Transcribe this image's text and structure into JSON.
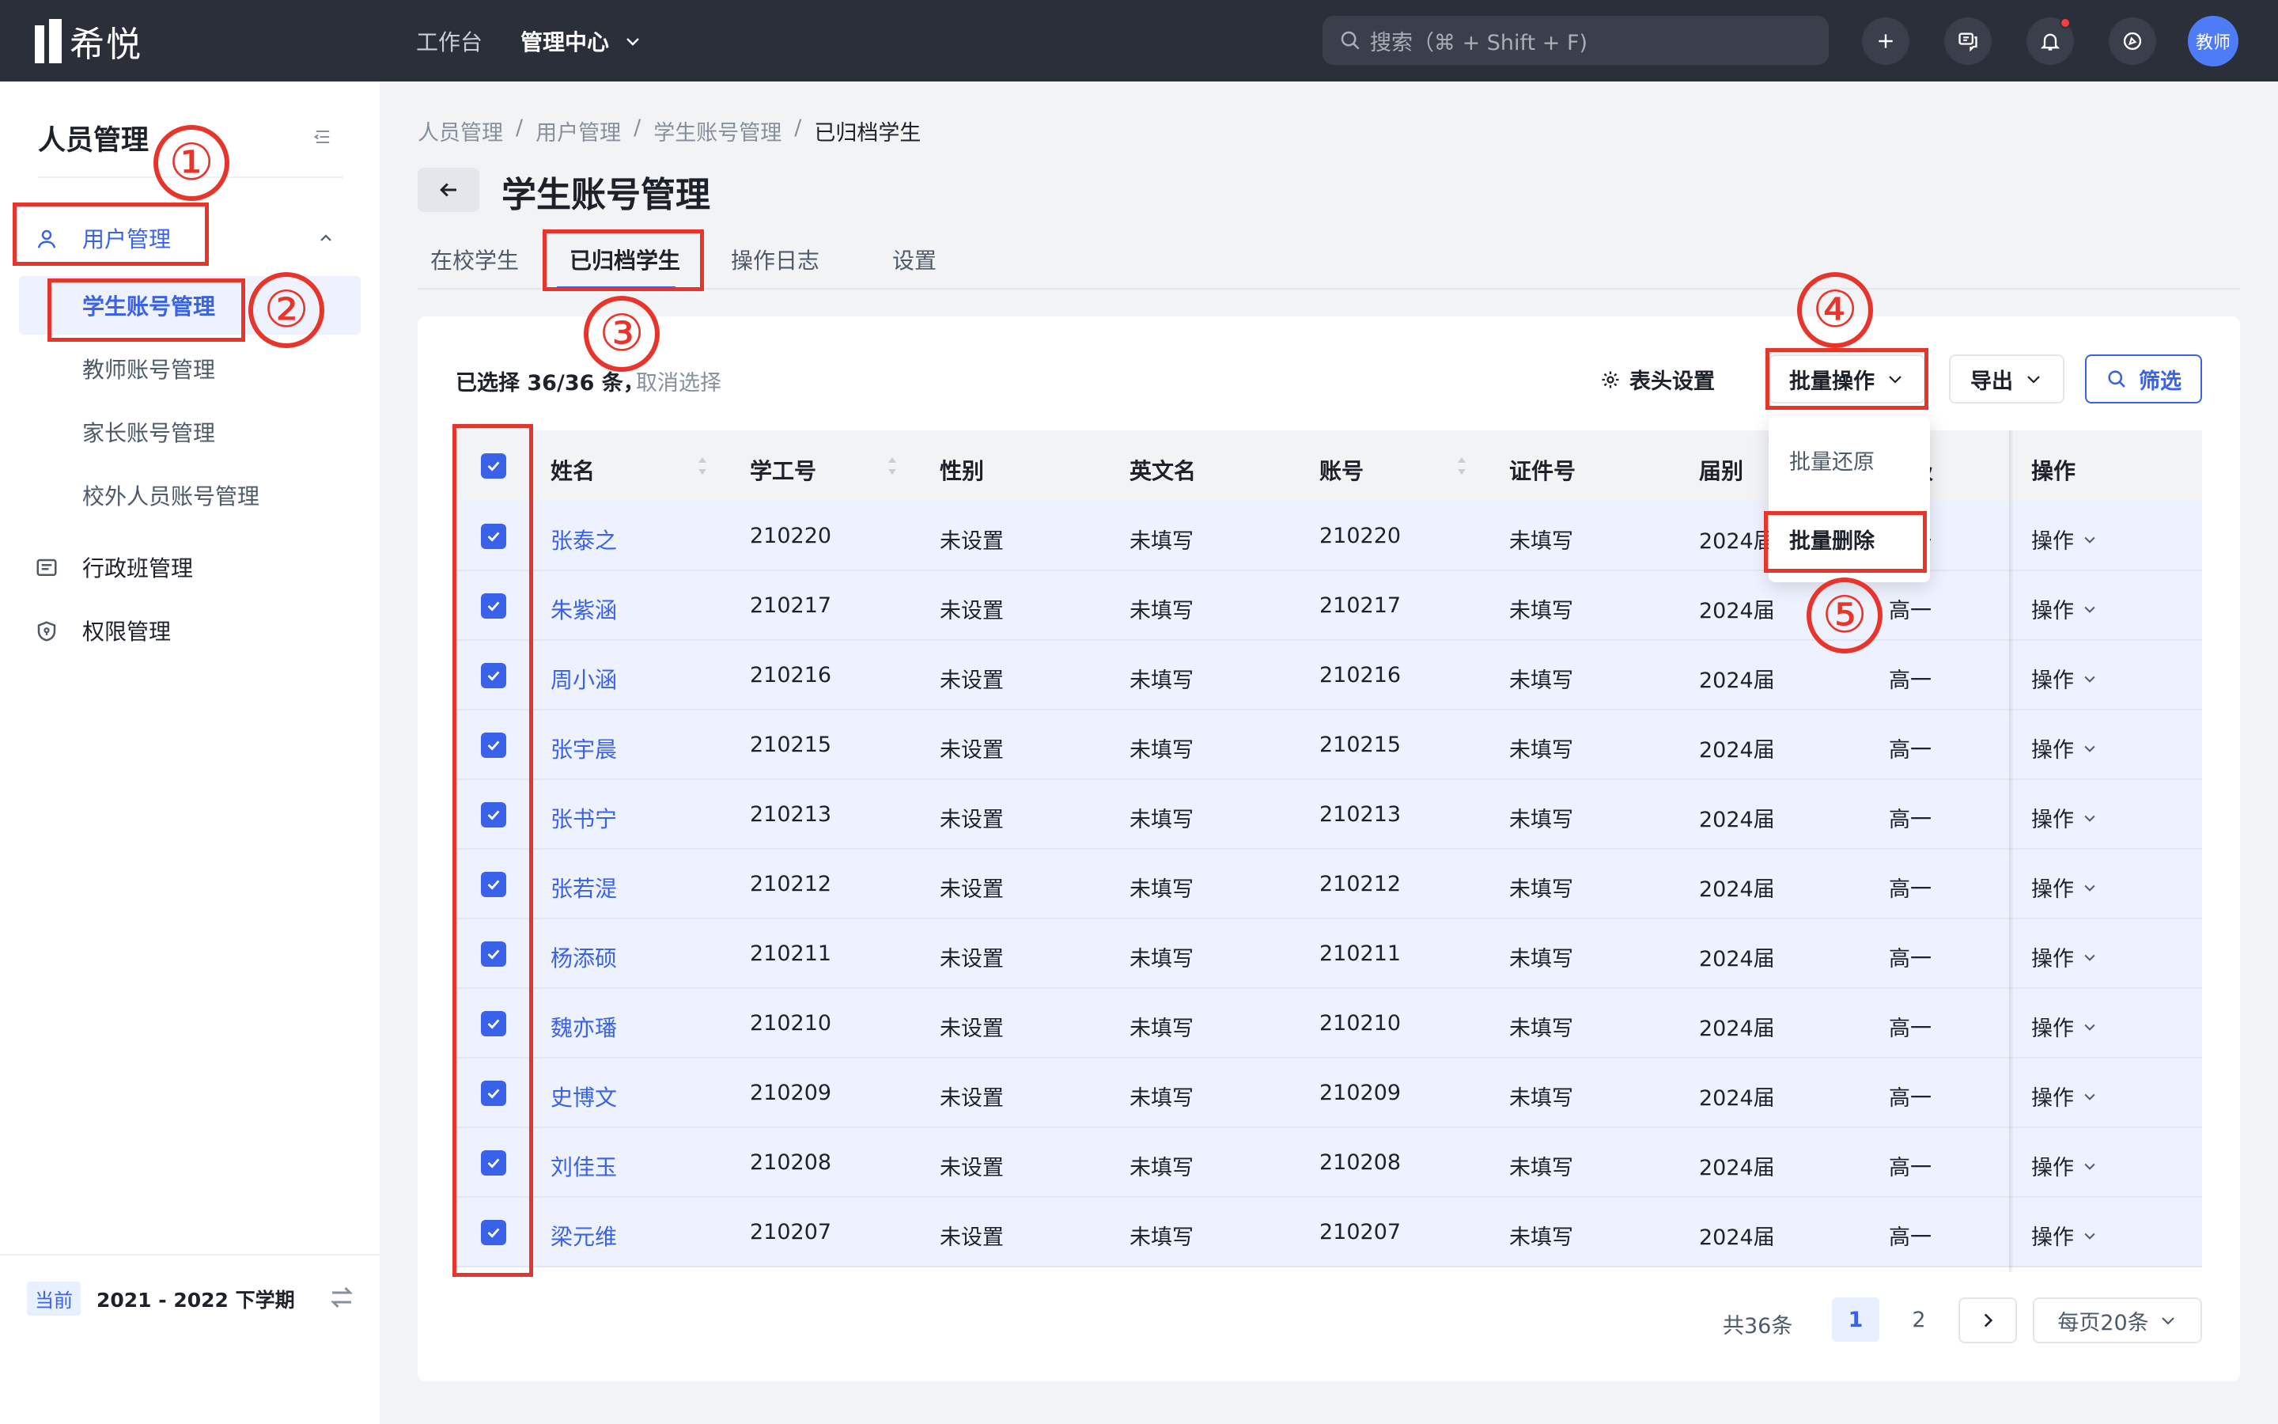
{
  "topbar": {
    "logo_text": "希悦",
    "nav_workbench": "工作台",
    "nav_admin": "管理中心",
    "search_placeholder": "搜索（⌘ + Shift + F)",
    "avatar_text": "教师",
    "notification_dot_color": "#f53f3f"
  },
  "sidebar": {
    "title": "人员管理",
    "group_user": "用户管理",
    "sub_items": [
      "学生账号管理",
      "教师账号管理",
      "家长账号管理",
      "校外人员账号管理"
    ],
    "item_class": "行政班管理",
    "item_perm": "权限管理",
    "term_badge": "当前",
    "term_text": "2021 - 2022 下学期"
  },
  "breadcrumb": [
    "人员管理",
    "用户管理",
    "学生账号管理",
    "已归档学生"
  ],
  "page_title": "学生账号管理",
  "tabs": [
    "在校学生",
    "已归档学生",
    "操作日志",
    "设置"
  ],
  "toolbar": {
    "selected_text": "已选择 36/36 条，",
    "cancel_select": "取消选择",
    "column_settings": "表头设置",
    "bulk_ops": "批量操作",
    "export": "导出",
    "filter": "筛选"
  },
  "dropdown": {
    "restore": "批量还原",
    "delete": "批量删除"
  },
  "table": {
    "headers": [
      "姓名",
      "学工号",
      "性别",
      "英文名",
      "账号",
      "证件号",
      "届别",
      "年级",
      "操作"
    ],
    "rows": [
      {
        "name": "张泰之",
        "id": "210220",
        "gender": "未设置",
        "en": "未填写",
        "account": "210220",
        "cert": "未填写",
        "cohort": "2024届",
        "grade": "高一",
        "op": "操作"
      },
      {
        "name": "朱紫涵",
        "id": "210217",
        "gender": "未设置",
        "en": "未填写",
        "account": "210217",
        "cert": "未填写",
        "cohort": "2024届",
        "grade": "高一",
        "op": "操作"
      },
      {
        "name": "周小涵",
        "id": "210216",
        "gender": "未设置",
        "en": "未填写",
        "account": "210216",
        "cert": "未填写",
        "cohort": "2024届",
        "grade": "高一",
        "op": "操作"
      },
      {
        "name": "张宇晨",
        "id": "210215",
        "gender": "未设置",
        "en": "未填写",
        "account": "210215",
        "cert": "未填写",
        "cohort": "2024届",
        "grade": "高一",
        "op": "操作"
      },
      {
        "name": "张书宁",
        "id": "210213",
        "gender": "未设置",
        "en": "未填写",
        "account": "210213",
        "cert": "未填写",
        "cohort": "2024届",
        "grade": "高一",
        "op": "操作"
      },
      {
        "name": "张若湜",
        "id": "210212",
        "gender": "未设置",
        "en": "未填写",
        "account": "210212",
        "cert": "未填写",
        "cohort": "2024届",
        "grade": "高一",
        "op": "操作"
      },
      {
        "name": "杨添硕",
        "id": "210211",
        "gender": "未设置",
        "en": "未填写",
        "account": "210211",
        "cert": "未填写",
        "cohort": "2024届",
        "grade": "高一",
        "op": "操作"
      },
      {
        "name": "魏亦璠",
        "id": "210210",
        "gender": "未设置",
        "en": "未填写",
        "account": "210210",
        "cert": "未填写",
        "cohort": "2024届",
        "grade": "高一",
        "op": "操作"
      },
      {
        "name": "史博文",
        "id": "210209",
        "gender": "未设置",
        "en": "未填写",
        "account": "210209",
        "cert": "未填写",
        "cohort": "2024届",
        "grade": "高一",
        "op": "操作"
      },
      {
        "name": "刘佳玉",
        "id": "210208",
        "gender": "未设置",
        "en": "未填写",
        "account": "210208",
        "cert": "未填写",
        "cohort": "2024届",
        "grade": "高一",
        "op": "操作"
      },
      {
        "name": "梁元维",
        "id": "210207",
        "gender": "未设置",
        "en": "未填写",
        "account": "210207",
        "cert": "未填写",
        "cohort": "2024届",
        "grade": "高一",
        "op": "操作"
      }
    ]
  },
  "pagination": {
    "total": "共36条",
    "pages": [
      "1",
      "2"
    ],
    "page_size": "每页20条"
  },
  "annotations": [
    "①",
    "②",
    "③",
    "④",
    "⑤"
  ],
  "colors": {
    "accent": "#3a62e8",
    "annotation_red": "#e8352b",
    "topbar_bg": "#2b2f3a",
    "selected_row_bg": "#eef2fe"
  }
}
